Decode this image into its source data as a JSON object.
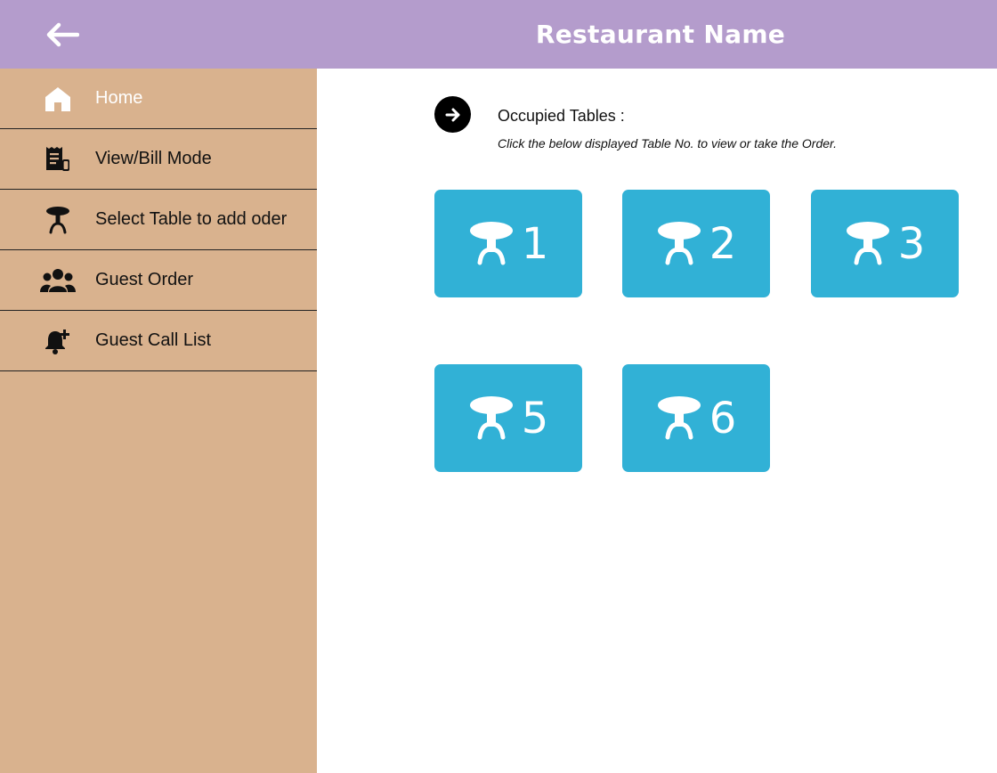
{
  "header": {
    "title": "Restaurant Name",
    "back_icon": "arrow-left-icon",
    "background": "#b49ccc"
  },
  "sidebar": {
    "background": "#d9b28e",
    "items": [
      {
        "label": "Home",
        "icon": "home-icon",
        "active": true
      },
      {
        "label": "View/Bill Mode",
        "icon": "receipt-icon",
        "active": false
      },
      {
        "label": "Select Table to add oder",
        "icon": "table-icon",
        "active": false
      },
      {
        "label": "Guest Order",
        "icon": "users-icon",
        "active": false
      },
      {
        "label": "Guest Call List",
        "icon": "bell-plus-icon",
        "active": false
      }
    ]
  },
  "main": {
    "section_icon": "arrow-right-circle-icon",
    "title": "Occupied Tables :",
    "hint": "Click the below displayed Table No. to view or take the Order.",
    "table_color": "#31b1d6",
    "tables": [
      {
        "number": "1",
        "icon": "table-icon"
      },
      {
        "number": "2",
        "icon": "table-icon"
      },
      {
        "number": "3",
        "icon": "table-icon"
      },
      {
        "number": "5",
        "icon": "table-icon"
      },
      {
        "number": "6",
        "icon": "table-icon"
      }
    ]
  }
}
